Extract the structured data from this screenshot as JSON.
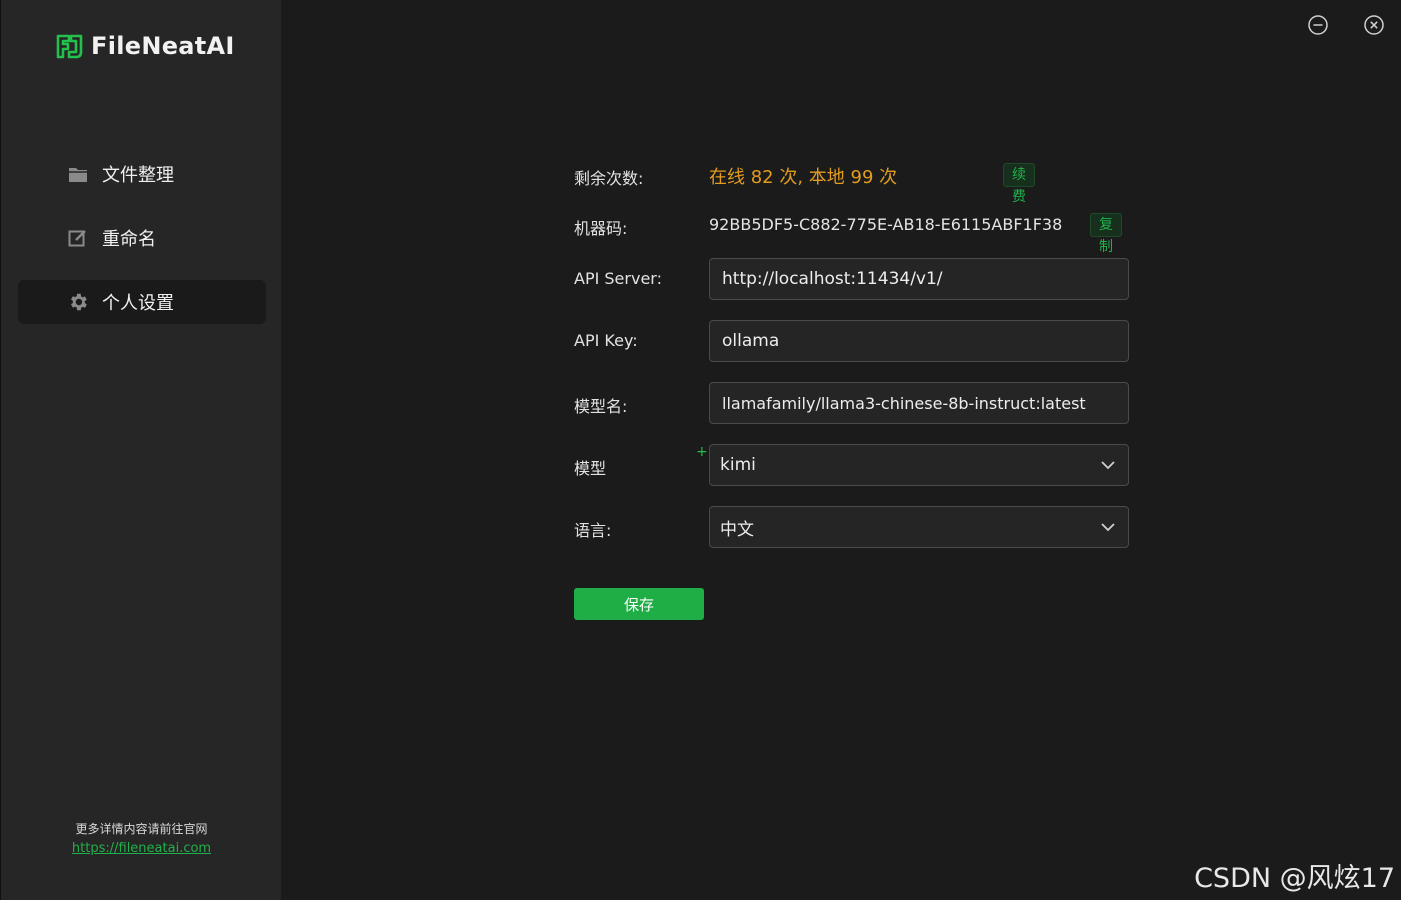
{
  "app": {
    "name": "FileNeatAI"
  },
  "sidebar": {
    "items": [
      {
        "label": "文件整理",
        "icon": "folder-icon",
        "active": false
      },
      {
        "label": "重命名",
        "icon": "edit-icon",
        "active": false
      },
      {
        "label": "个人设置",
        "icon": "gear-icon",
        "active": true
      }
    ],
    "footer_hint": "更多详情内容请前往官网",
    "footer_link": "https://fileneatai.com"
  },
  "settings": {
    "quota_label": "剩余次数:",
    "quota_value": "在线 82 次, 本地 99 次",
    "renew_label": "续费",
    "machine_label": "机器码:",
    "machine_value": "92BB5DF5-C882-775E-AB18-E6115ABF1F38",
    "copy_label": "复制",
    "api_server_label": "API Server:",
    "api_server_value": "http://localhost:11434/v1/",
    "api_key_label": "API Key:",
    "api_key_value": "ollama",
    "model_name_label": "模型名:",
    "model_name_value": "llamafamily/llama3-chinese-8b-instruct:latest",
    "model_label": "模型",
    "model_required_mark": "+",
    "model_value": "kimi",
    "language_label": "语言:",
    "language_value": "中文",
    "save_label": "保存"
  },
  "colors": {
    "accent": "#1fae45",
    "quota": "#e39c1e",
    "sidebar_bg": "#262626",
    "main_bg": "#1b1b1b"
  },
  "watermark": "CSDN @风炫17"
}
